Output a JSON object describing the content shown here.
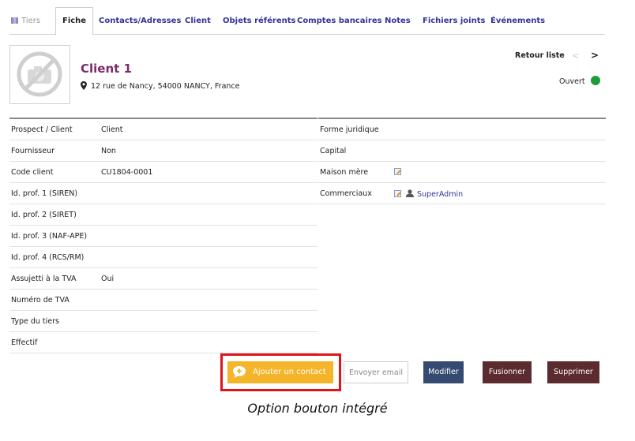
{
  "tabs": [
    {
      "label": "Tiers",
      "icon": "tiers-icon"
    },
    {
      "label": "Fiche",
      "active": true
    },
    {
      "label": "Contacts/Adresses"
    },
    {
      "label": "Client"
    },
    {
      "label": "Objets référents"
    },
    {
      "label": "Comptes bancaires"
    },
    {
      "label": "Notes"
    },
    {
      "label": "Fichiers joints"
    },
    {
      "label": "Événements"
    }
  ],
  "header": {
    "name": "Client 1",
    "address": "12 rue de Nancy, 54000 NANCY, France",
    "back_label": "Retour liste",
    "prev_glyph": "<",
    "next_glyph": ">",
    "status": "Ouvert",
    "status_color": "#1f9d3a"
  },
  "left_table": [
    {
      "label": "Prospect / Client",
      "value": "Client"
    },
    {
      "label": "Fournisseur",
      "value": "Non"
    },
    {
      "label": "Code client",
      "value": "CU1804-0001"
    },
    {
      "label": "Id. prof. 1 (SIREN)",
      "value": ""
    },
    {
      "label": "Id. prof. 2 (SIRET)",
      "value": ""
    },
    {
      "label": "Id. prof. 3 (NAF-APE)",
      "value": ""
    },
    {
      "label": "Id. prof. 4 (RCS/RM)",
      "value": ""
    },
    {
      "label": "Assujetti à la TVA",
      "value": "Oui"
    },
    {
      "label": "Numéro de TVA",
      "value": ""
    },
    {
      "label": "Type du tiers",
      "value": ""
    },
    {
      "label": "Effectif",
      "value": ""
    }
  ],
  "right_table": [
    {
      "label": "Forme juridique",
      "value": ""
    },
    {
      "label": "Capital",
      "value": ""
    },
    {
      "label": "Maison mère",
      "value": ""
    },
    {
      "label": "Commerciaux",
      "value": "SuperAdmin"
    }
  ],
  "buttons": {
    "add_contact": "Ajouter un contact",
    "send_email": "Envoyer email",
    "modify": "Modifier",
    "merge": "Fusionner",
    "delete": "Supprimer"
  },
  "colors": {
    "add_contact_bg": "#f4b52a",
    "modify_bg": "#344a70",
    "merge_bg": "#5c2b2f",
    "delete_bg": "#5c2b2f",
    "highlight_border": "#e0141b",
    "name_color": "#7a2d67"
  },
  "caption": "Option bouton intégré"
}
